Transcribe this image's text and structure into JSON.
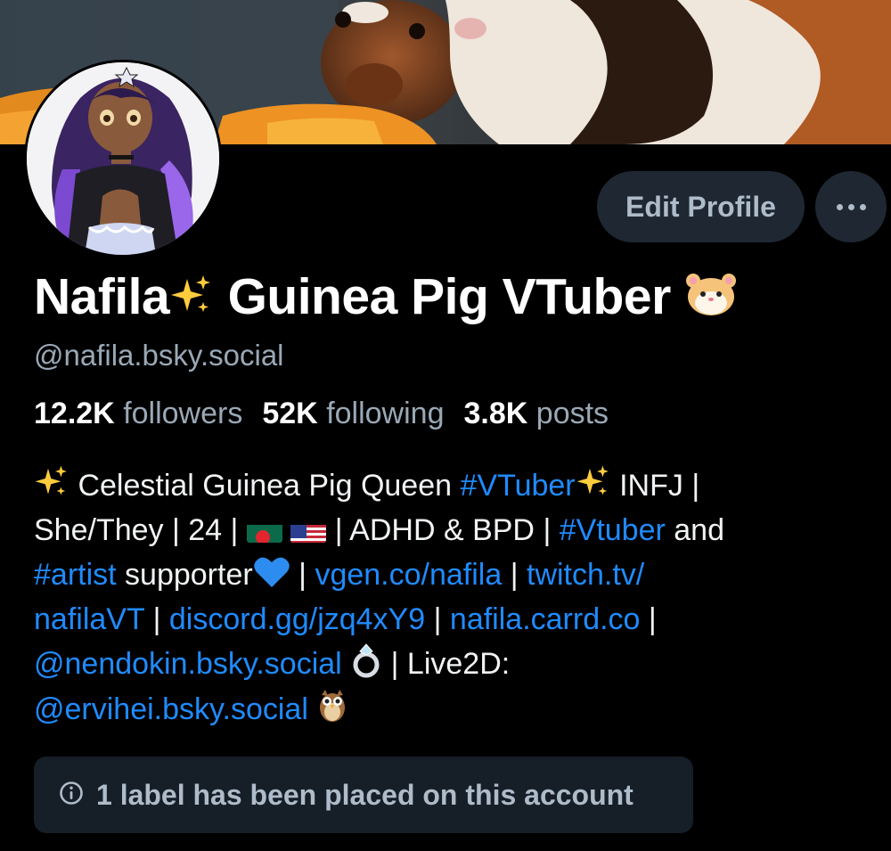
{
  "profile": {
    "display_name": "Nafila",
    "display_name_rest": " Guinea Pig VTuber",
    "handle": "@nafila.bsky.social",
    "followers_count": "12.2K",
    "followers_label": "followers",
    "following_count": "52K",
    "following_label": "following",
    "posts_count": "3.8K",
    "posts_label": "posts"
  },
  "actions": {
    "edit_profile_label": "Edit Profile",
    "more_icon": "ellipsis-icon"
  },
  "bio": {
    "l1_a": " Celestial Guinea Pig Queen ",
    "l1_tag": "#VTuber",
    "l1_b": " INFJ ",
    "l2_a": "She/They ",
    "l2_b": " 24  ",
    "l2_c": " ADHD & BPD ",
    "l2_tag": "#Vtuber",
    "l2_d": " and",
    "l3_tag": "#artist",
    "l3_a": " supporter",
    "l3_link1": "vgen.co/nafila",
    "l3_link2": "twitch.tv/",
    "l4_link1": "nafilaVT",
    "l4_link2": "discord.gg/jzq4xY9",
    "l4_link3": "nafila.carrd.co",
    "l5_link": "@nendokin.bsky.social",
    "l5_a": " Live2D:",
    "l6_link": "@ervihei.bsky.social",
    "separator": "|"
  },
  "labels": {
    "notice": "1 label has been placed on this account",
    "icon": "info-icon"
  },
  "colors": {
    "background": "#000000",
    "link": "#208bfe",
    "muted": "#9aa8b6",
    "button_bg": "#1e2732",
    "label_box_bg": "#161e27"
  }
}
